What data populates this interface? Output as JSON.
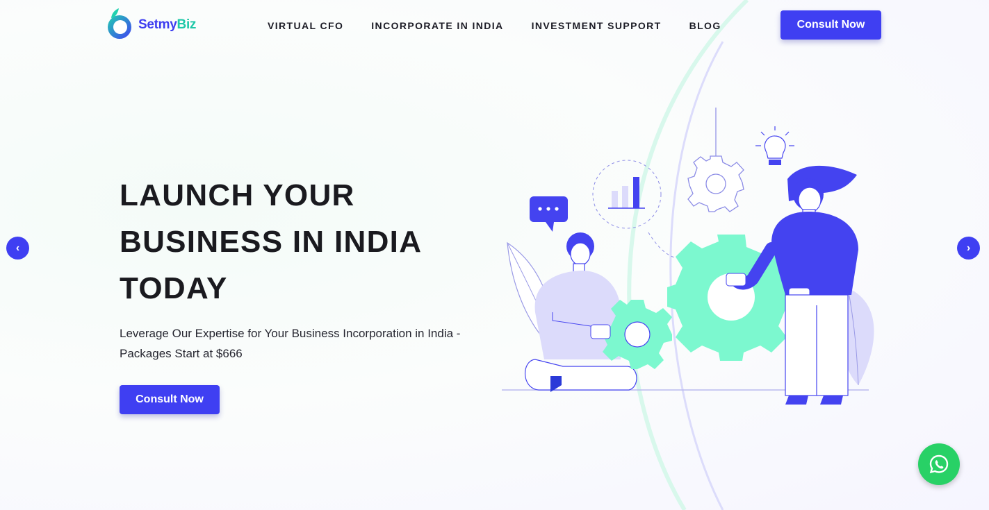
{
  "brand": {
    "name_part1": "Setmy",
    "name_part2": "Biz",
    "primary_color": "#3f3ff2",
    "accent_color": "#1fc8a8"
  },
  "nav": {
    "items": [
      "VIRTUAL CFO",
      "INCORPORATE IN INDIA",
      "INVESTMENT SUPPORT",
      "BLOG"
    ],
    "cta_label": "Consult Now"
  },
  "hero": {
    "title_lines": [
      "LAUNCH YOUR",
      "BUSINESS IN INDIA",
      "TODAY"
    ],
    "subtitle": "Leverage Our Expertise for Your Business Incorporation in India - Packages Start at $666",
    "cta_label": "Consult Now"
  },
  "slider": {
    "prev_icon": "chevron-left-icon",
    "next_icon": "chevron-right-icon",
    "prev_glyph": "‹",
    "next_glyph": "›"
  },
  "whatsapp": {
    "icon": "whatsapp-icon",
    "color": "#28d166"
  },
  "illustration": {
    "gear_color": "#7cf8cf",
    "figure_color": "#4443f0",
    "figure_light_color": "#dcdbfb"
  }
}
